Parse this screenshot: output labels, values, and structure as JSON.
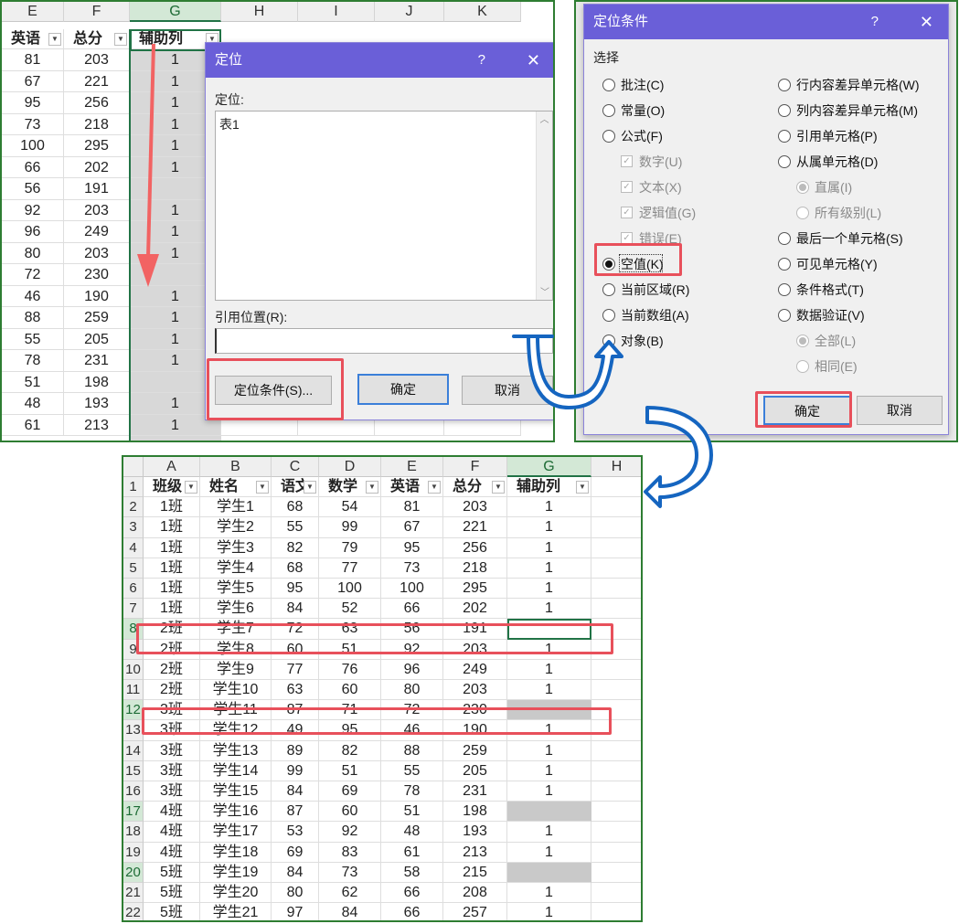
{
  "top_sheet": {
    "col_headers": [
      "E",
      "F",
      "G",
      "H",
      "I",
      "J",
      "K"
    ],
    "header_cells": {
      "e": "英语",
      "f": "总分",
      "g": "辅助列"
    },
    "rows": [
      {
        "e": "81",
        "f": "203",
        "g": "1"
      },
      {
        "e": "67",
        "f": "221",
        "g": "1"
      },
      {
        "e": "95",
        "f": "256",
        "g": "1"
      },
      {
        "e": "73",
        "f": "218",
        "g": "1"
      },
      {
        "e": "100",
        "f": "295",
        "g": "1"
      },
      {
        "e": "66",
        "f": "202",
        "g": "1"
      },
      {
        "e": "56",
        "f": "191",
        "g": ""
      },
      {
        "e": "92",
        "f": "203",
        "g": "1"
      },
      {
        "e": "96",
        "f": "249",
        "g": "1"
      },
      {
        "e": "80",
        "f": "203",
        "g": "1"
      },
      {
        "e": "72",
        "f": "230",
        "g": ""
      },
      {
        "e": "46",
        "f": "190",
        "g": "1"
      },
      {
        "e": "88",
        "f": "259",
        "g": "1"
      },
      {
        "e": "55",
        "f": "205",
        "g": "1"
      },
      {
        "e": "78",
        "f": "231",
        "g": "1"
      },
      {
        "e": "51",
        "f": "198",
        "g": ""
      },
      {
        "e": "48",
        "f": "193",
        "g": "1"
      },
      {
        "e": "61",
        "f": "213",
        "g": "1"
      }
    ]
  },
  "goto_dialog": {
    "title": "定位",
    "help": "?",
    "close": "✕",
    "goto_label": "定位:",
    "list_items": [
      "表1"
    ],
    "reference_label": "引用位置(R):",
    "reference_value": "",
    "special_button": "定位条件(S)...",
    "ok_button": "确定",
    "cancel_button": "取消"
  },
  "special_dialog": {
    "title": "定位条件",
    "help": "?",
    "close": "✕",
    "group_label": "选择",
    "left_options": [
      {
        "label": "批注(C)",
        "kind": "radio",
        "checked": false,
        "disabled": false
      },
      {
        "label": "常量(O)",
        "kind": "radio",
        "checked": false,
        "disabled": false
      },
      {
        "label": "公式(F)",
        "kind": "radio",
        "checked": false,
        "disabled": false
      },
      {
        "label": "数字(U)",
        "kind": "check",
        "checked": true,
        "disabled": true
      },
      {
        "label": "文本(X)",
        "kind": "check",
        "checked": true,
        "disabled": true
      },
      {
        "label": "逻辑值(G)",
        "kind": "check",
        "checked": true,
        "disabled": true
      },
      {
        "label": "错误(E)",
        "kind": "check",
        "checked": true,
        "disabled": true
      },
      {
        "label": "空值(K)",
        "kind": "radio",
        "checked": true,
        "disabled": false
      },
      {
        "label": "当前区域(R)",
        "kind": "radio",
        "checked": false,
        "disabled": false
      },
      {
        "label": "当前数组(A)",
        "kind": "radio",
        "checked": false,
        "disabled": false
      },
      {
        "label": "对象(B)",
        "kind": "radio",
        "checked": false,
        "disabled": false
      }
    ],
    "right_options": [
      {
        "label": "行内容差异单元格(W)",
        "kind": "radio",
        "checked": false,
        "disabled": false
      },
      {
        "label": "列内容差异单元格(M)",
        "kind": "radio",
        "checked": false,
        "disabled": false
      },
      {
        "label": "引用单元格(P)",
        "kind": "radio",
        "checked": false,
        "disabled": false
      },
      {
        "label": "从属单元格(D)",
        "kind": "radio",
        "checked": false,
        "disabled": false
      },
      {
        "label": "直属(I)",
        "kind": "radio",
        "checked": true,
        "disabled": true
      },
      {
        "label": "所有级别(L)",
        "kind": "radio",
        "checked": false,
        "disabled": true
      },
      {
        "label": "最后一个单元格(S)",
        "kind": "radio",
        "checked": false,
        "disabled": false
      },
      {
        "label": "可见单元格(Y)",
        "kind": "radio",
        "checked": false,
        "disabled": false
      },
      {
        "label": "条件格式(T)",
        "kind": "radio",
        "checked": false,
        "disabled": false
      },
      {
        "label": "数据验证(V)",
        "kind": "radio",
        "checked": false,
        "disabled": false
      },
      {
        "label": "全部(L)",
        "kind": "radio",
        "checked": true,
        "disabled": true
      },
      {
        "label": "相同(E)",
        "kind": "radio",
        "checked": false,
        "disabled": true
      }
    ],
    "ok_button": "确定",
    "cancel_button": "取消"
  },
  "bottom_sheet": {
    "col_headers": [
      "A",
      "B",
      "C",
      "D",
      "E",
      "F",
      "G",
      "H"
    ],
    "headers": [
      "班级",
      "姓名",
      "语文",
      "数学",
      "英语",
      "总分",
      "辅助列"
    ],
    "row_numbers": [
      "1",
      "2",
      "3",
      "4",
      "5",
      "6",
      "7",
      "8",
      "9",
      "10",
      "11",
      "12",
      "13",
      "14",
      "15",
      "16",
      "17",
      "18",
      "19",
      "20",
      "21",
      "22"
    ],
    "rows": [
      [
        "1班",
        "学生1",
        "68",
        "54",
        "81",
        "203",
        "1"
      ],
      [
        "1班",
        "学生2",
        "55",
        "99",
        "67",
        "221",
        "1"
      ],
      [
        "1班",
        "学生3",
        "82",
        "79",
        "95",
        "256",
        "1"
      ],
      [
        "1班",
        "学生4",
        "68",
        "77",
        "73",
        "218",
        "1"
      ],
      [
        "1班",
        "学生5",
        "95",
        "100",
        "100",
        "295",
        "1"
      ],
      [
        "1班",
        "学生6",
        "84",
        "52",
        "66",
        "202",
        "1"
      ],
      [
        "2班",
        "学生7",
        "72",
        "63",
        "56",
        "191",
        ""
      ],
      [
        "2班",
        "学生8",
        "60",
        "51",
        "92",
        "203",
        "1"
      ],
      [
        "2班",
        "学生9",
        "77",
        "76",
        "96",
        "249",
        "1"
      ],
      [
        "2班",
        "学生10",
        "63",
        "60",
        "80",
        "203",
        "1"
      ],
      [
        "3班",
        "学生11",
        "87",
        "71",
        "72",
        "230",
        ""
      ],
      [
        "3班",
        "学生12",
        "49",
        "95",
        "46",
        "190",
        "1"
      ],
      [
        "3班",
        "学生13",
        "89",
        "82",
        "88",
        "259",
        "1"
      ],
      [
        "3班",
        "学生14",
        "99",
        "51",
        "55",
        "205",
        "1"
      ],
      [
        "3班",
        "学生15",
        "84",
        "69",
        "78",
        "231",
        "1"
      ],
      [
        "4班",
        "学生16",
        "87",
        "60",
        "51",
        "198",
        ""
      ],
      [
        "4班",
        "学生17",
        "53",
        "92",
        "48",
        "193",
        "1"
      ],
      [
        "4班",
        "学生18",
        "69",
        "83",
        "61",
        "213",
        "1"
      ],
      [
        "5班",
        "学生19",
        "84",
        "73",
        "58",
        "215",
        ""
      ],
      [
        "5班",
        "学生20",
        "80",
        "62",
        "66",
        "208",
        "1"
      ],
      [
        "5班",
        "学生21",
        "97",
        "84",
        "66",
        "257",
        "1"
      ]
    ]
  }
}
